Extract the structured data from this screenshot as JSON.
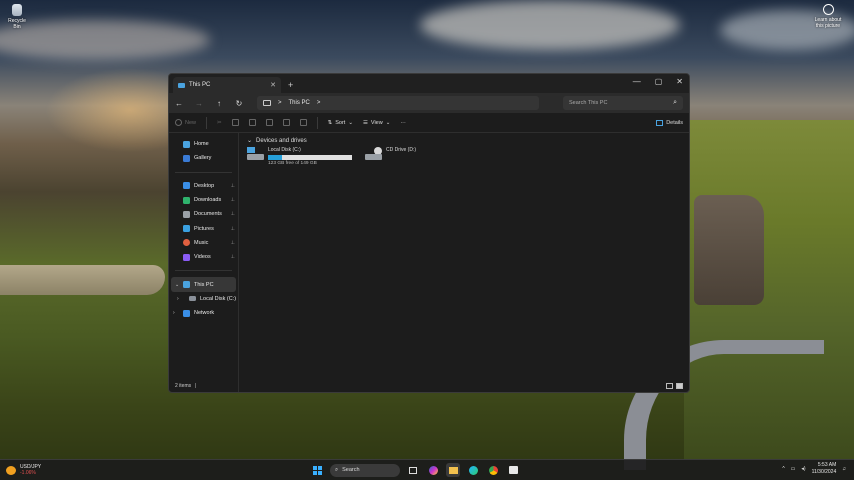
{
  "desktop": {
    "recycle_bin_label": "Recycle Bin",
    "learn_label_line1": "Learn about",
    "learn_label_line2": "this picture"
  },
  "window": {
    "tab_title": "This PC",
    "close_tab_glyph": "✕",
    "new_tab_glyph": "+",
    "controls": {
      "minimize": "—",
      "maximize": "▢",
      "close": "✕"
    }
  },
  "address_bar": {
    "back": "←",
    "forward": "→",
    "up": "↑",
    "refresh": "↻",
    "path_chevron": ">",
    "location": "This PC",
    "trailing_chevron": ">",
    "search_placeholder": "Search This PC",
    "search_icon": "⌕"
  },
  "command_bar": {
    "new_label": "New",
    "sort_label": "Sort",
    "view_label": "View",
    "more_glyph": "···",
    "details_label": "Details"
  },
  "nav_pane": {
    "top": [
      {
        "label": "Home",
        "icon": "home-icon",
        "color": "#4aa3df"
      },
      {
        "label": "Gallery",
        "icon": "gallery-icon",
        "color": "#3a7bd5"
      }
    ],
    "quick": [
      {
        "label": "Desktop",
        "icon": "desktop-folder-icon",
        "color": "#3a8ee6"
      },
      {
        "label": "Downloads",
        "icon": "downloads-icon",
        "color": "#2fb36d"
      },
      {
        "label": "Documents",
        "icon": "documents-icon",
        "color": "#9aa0a6"
      },
      {
        "label": "Pictures",
        "icon": "pictures-icon",
        "color": "#3aa0e0"
      },
      {
        "label": "Music",
        "icon": "music-icon",
        "color": "#e06040"
      },
      {
        "label": "Videos",
        "icon": "videos-icon",
        "color": "#8b5cf6"
      }
    ],
    "pin_glyph": "📌",
    "tree": [
      {
        "label": "This PC",
        "chevron": "⌄",
        "selected": true
      },
      {
        "label": "Local Disk (C:)",
        "chevron": "›",
        "selected": false
      },
      {
        "label": "Network",
        "chevron": "›",
        "selected": false
      }
    ]
  },
  "content": {
    "group_header": "Devices and drives",
    "group_chevron": "⌄",
    "drives": [
      {
        "name": "Local Disk (C:)",
        "usage_fraction": 0.17,
        "free_text": "123 GB free of 149 GB",
        "has_bar": true
      },
      {
        "name": "CD Drive (D:)",
        "usage_fraction": null,
        "free_text": "",
        "has_bar": false
      }
    ]
  },
  "status_bar": {
    "item_count": "2 items",
    "separator": "|"
  },
  "taskbar": {
    "stock_name": "USD/JPY",
    "stock_change": "-1.06%",
    "search_label": "Search",
    "tray_chevron": "^",
    "time": "5:53 AM",
    "date": "11/30/2024"
  }
}
